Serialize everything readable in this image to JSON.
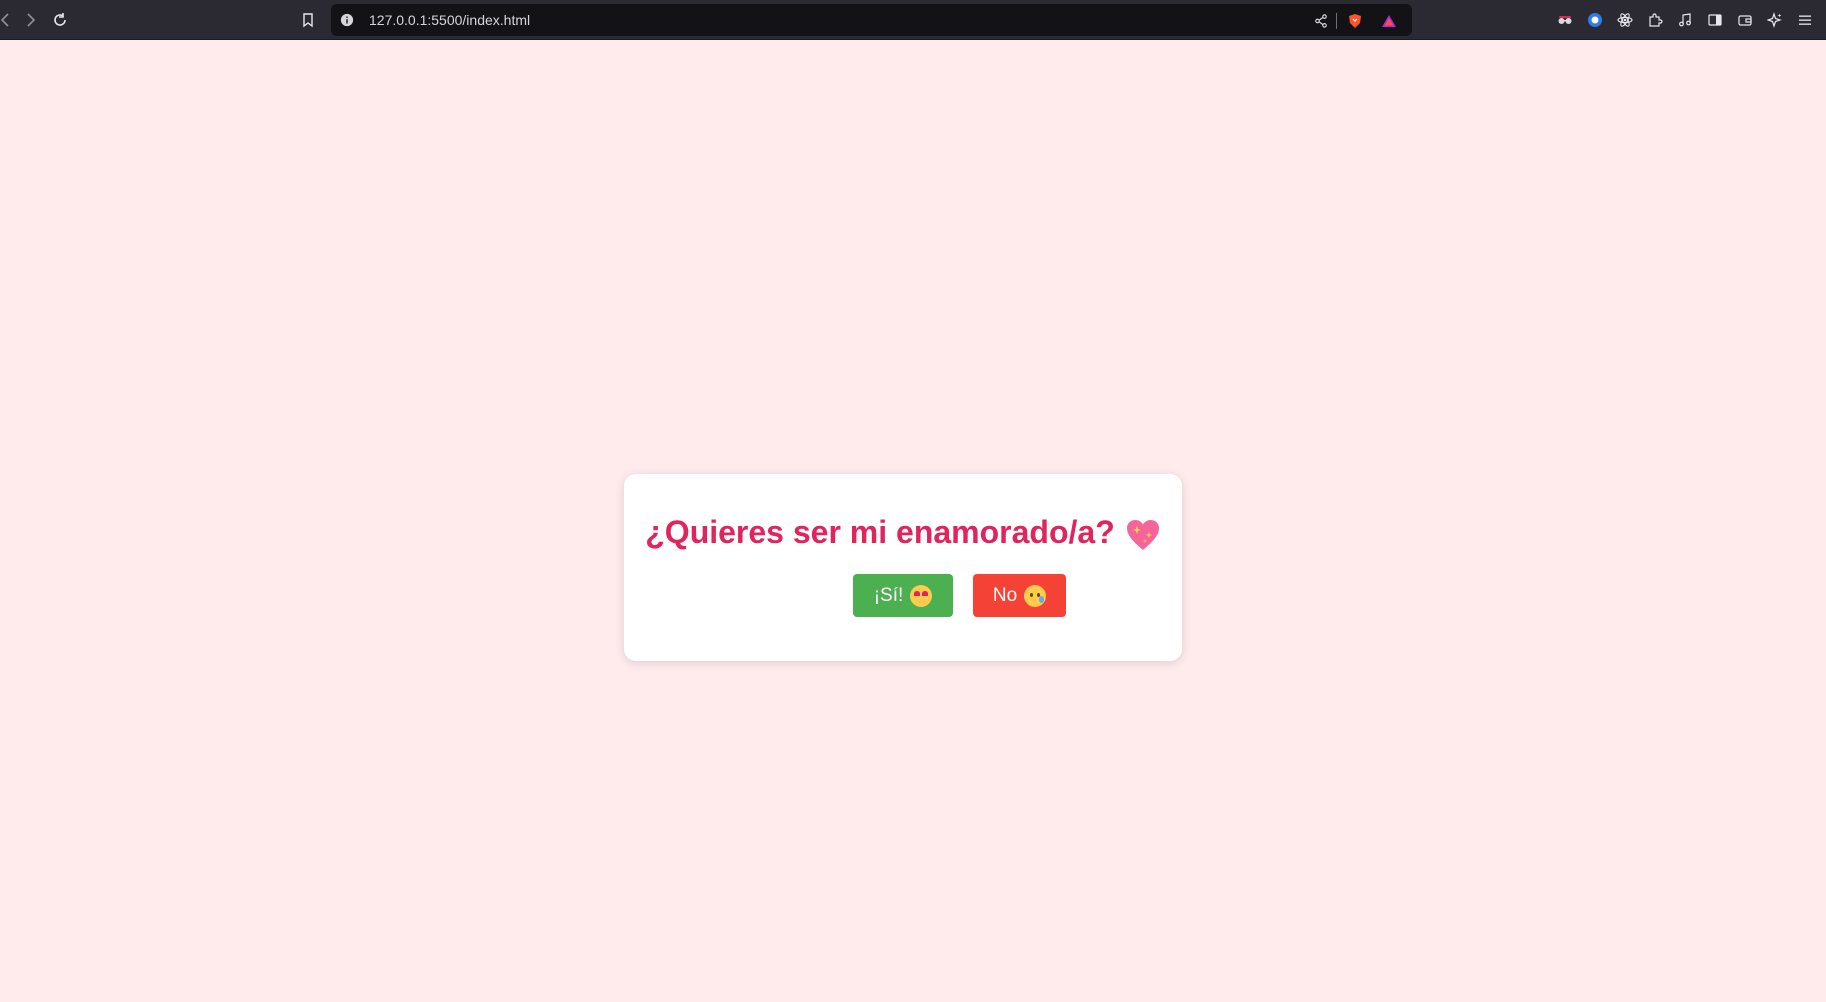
{
  "browser": {
    "url": "127.0.0.1:5500/index.html",
    "colors": {
      "toolbar": "#2b2a33",
      "urlbar": "#131216",
      "brave_orange": "#fb542b"
    },
    "nav_icons": [
      "back-icon",
      "forward-icon",
      "reload-icon",
      "bookmark-icon"
    ],
    "url_icons": [
      "site-info-icon",
      "share-icon",
      "brave-shields-icon",
      "brave-rewards-icon"
    ],
    "extension_icons": [
      "extension-glasses-icon",
      "extension-blue-icon",
      "react-devtools-icon",
      "extensions-puzzle-icon",
      "music-icon",
      "sidebar-icon",
      "wallet-icon",
      "leo-ai-icon",
      "menu-icon"
    ]
  },
  "page": {
    "background": "#ffeaec",
    "question": "¿Quieres ser mi enamorado/a?",
    "question_color": "#e0245e",
    "question_emoji": "sparkling-heart-icon",
    "buttons": {
      "yes_label": "¡Sí!",
      "yes_emoji": "heart-eyes-icon",
      "yes_color": "#4caf50",
      "no_label": "No",
      "no_emoji": "crying-face-icon",
      "no_color": "#f44336"
    }
  }
}
